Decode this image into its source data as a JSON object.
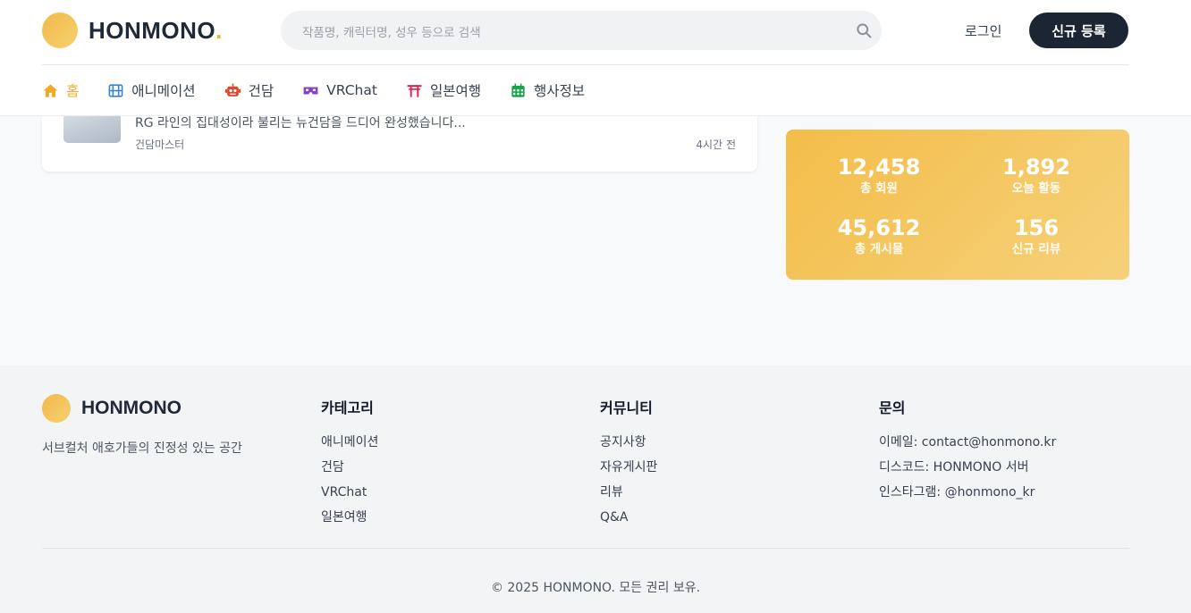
{
  "header": {
    "logo_text": "HONMONO",
    "logo_dot": ".",
    "search_placeholder": "작품명, 캐릭터명, 성우 등으로 검색",
    "login_label": "로그인",
    "signup_label": "신규 등록"
  },
  "nav": {
    "items": [
      {
        "label": "홈",
        "icon": "home-icon",
        "active": true
      },
      {
        "label": "애니메이션",
        "icon": "film-icon"
      },
      {
        "label": "건담",
        "icon": "robot-icon"
      },
      {
        "label": "VRChat",
        "icon": "vr-headset-icon"
      },
      {
        "label": "일본여행",
        "icon": "torii-icon"
      },
      {
        "label": "행사정보",
        "icon": "calendar-icon"
      }
    ]
  },
  "post": {
    "excerpt": "RG 라인의 집대성이라 불리는 뉴건담을 드디어 완성했습니다...",
    "author": "건담마스터",
    "time": "4시간 전"
  },
  "stats": [
    {
      "value": "12,458",
      "label": "총 회원"
    },
    {
      "value": "1,892",
      "label": "오늘 활동"
    },
    {
      "value": "45,612",
      "label": "총 게시물"
    },
    {
      "value": "156",
      "label": "신규 리뷰"
    }
  ],
  "footer": {
    "logo_text": "HONMONO",
    "tagline": "서브컬처 애호가들의 진정성 있는 공간",
    "columns": [
      {
        "title": "카테고리",
        "items": [
          "애니메이션",
          "건담",
          "VRChat",
          "일본여행"
        ]
      },
      {
        "title": "커뮤니티",
        "items": [
          "공지사항",
          "자유게시판",
          "리뷰",
          "Q&A"
        ]
      },
      {
        "title": "문의",
        "items": [
          "이메일: contact@honmono.kr",
          "디스코드: HONMONO 서버",
          "인스타그램: @honmono_kr"
        ]
      }
    ],
    "copyright": "© 2025 HONMONO. 모든 권리 보유."
  },
  "colors": {
    "accent": "#f0a929",
    "dark_button": "#1c2533",
    "stats_gradient_start": "#f3bd49",
    "stats_gradient_end": "#f6d17a"
  }
}
